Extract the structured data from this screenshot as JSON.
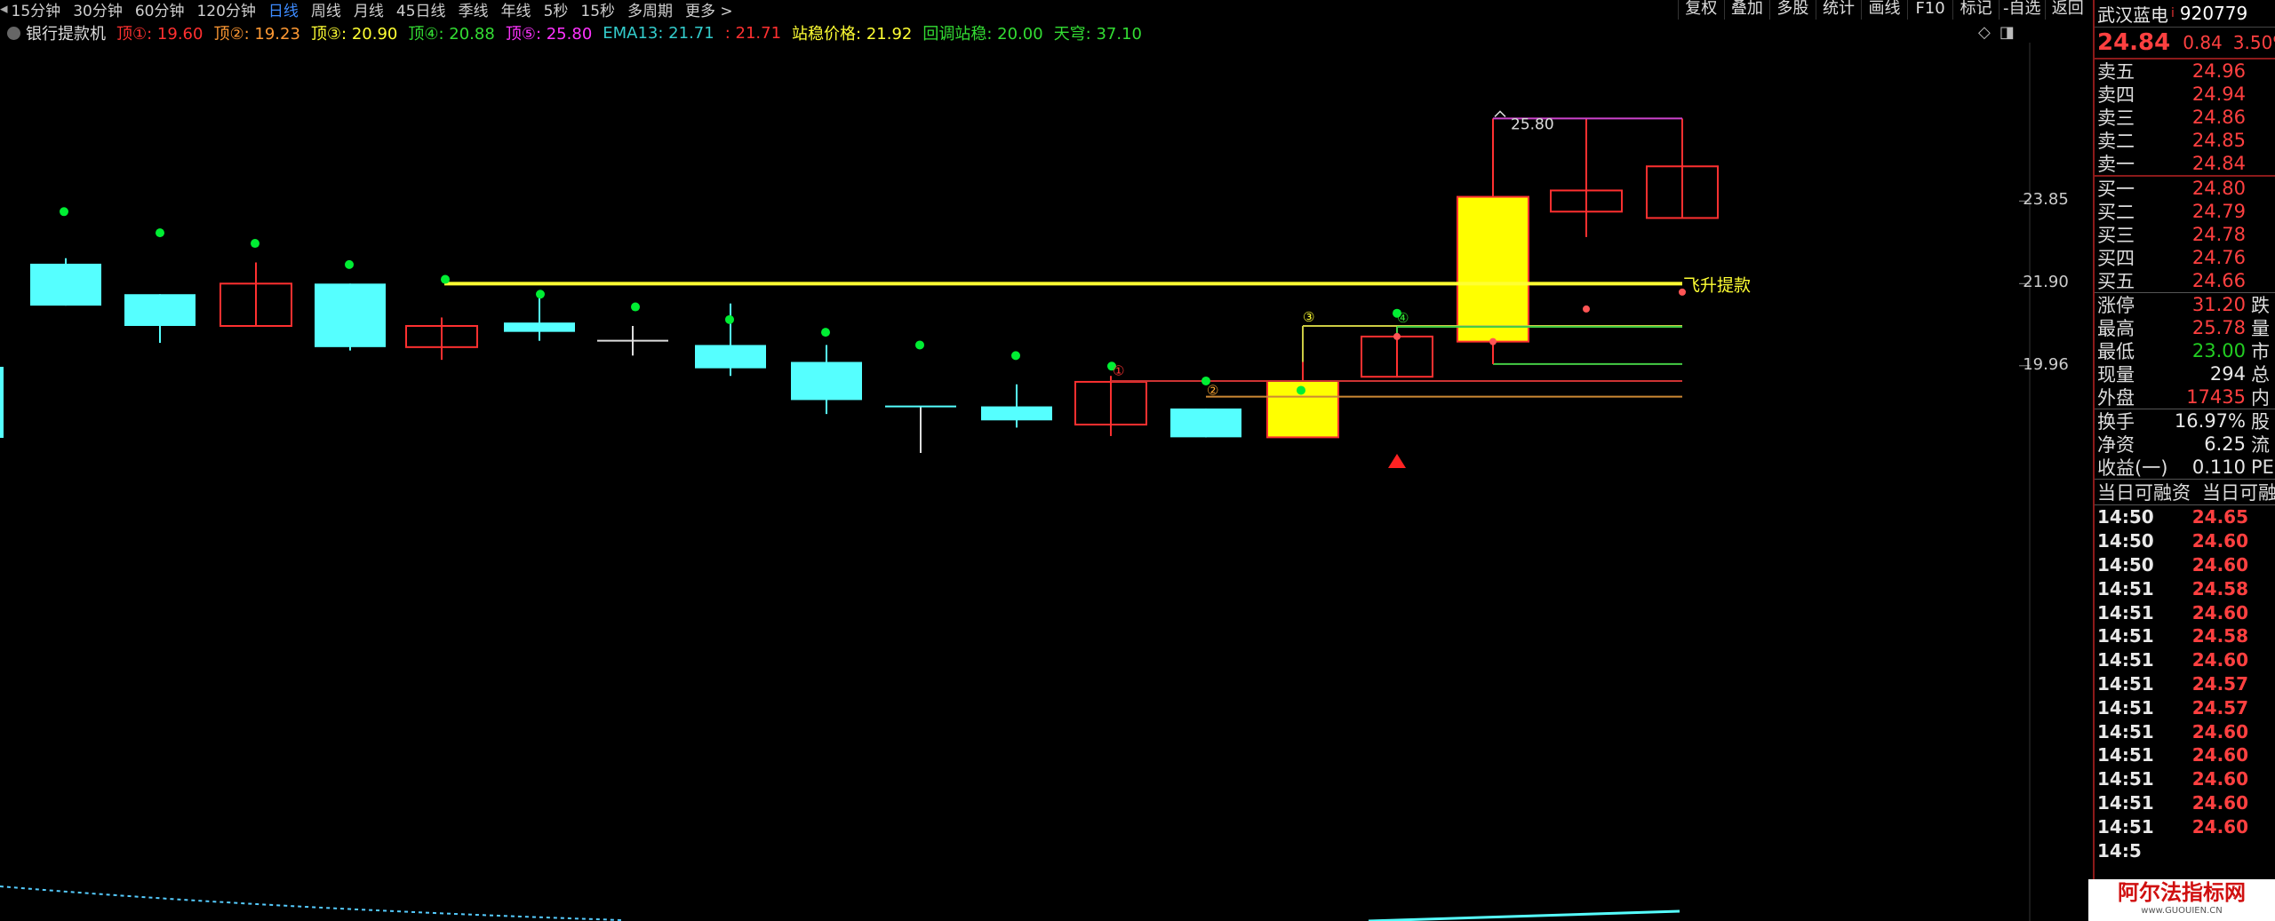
{
  "periods": {
    "items": [
      "15分钟",
      "30分钟",
      "60分钟",
      "120分钟",
      "日线",
      "周线",
      "月线",
      "45日线",
      "季线",
      "年线",
      "5秒",
      "15秒",
      "多周期",
      "更多 >"
    ],
    "active_index": 4
  },
  "toolbar": {
    "buttons": [
      "复权",
      "叠加",
      "多股",
      "统计",
      "画线",
      "F10",
      "标记",
      "-自选",
      "返回"
    ]
  },
  "indicator": {
    "name": "银行提款机",
    "items": [
      {
        "text": "顶①: 19.60",
        "color": "#ff3030"
      },
      {
        "text": "顶②: 19.23",
        "color": "#ff9933"
      },
      {
        "text": "顶③: 20.90",
        "color": "#ffff33"
      },
      {
        "text": "顶④: 20.88",
        "color": "#33dd33"
      },
      {
        "text": "顶⑤: 25.80",
        "color": "#ff33ff"
      },
      {
        "text": "EMA13: 21.71",
        "color": "#33cccc"
      },
      {
        "text": ": 21.71",
        "color": "#ff3030"
      },
      {
        "text": "站稳价格: 21.92",
        "color": "#ffff33"
      },
      {
        "text": "回调站稳: 20.00",
        "color": "#33dd33"
      },
      {
        "text": "天穹: 37.10",
        "color": "#33dd33"
      }
    ]
  },
  "window_icons": [
    "◇",
    "◨"
  ],
  "chart": {
    "y_labels": [
      {
        "text": "23.85",
        "value": 23.85
      },
      {
        "text": "21.90",
        "value": 21.9
      },
      {
        "text": "19.96",
        "value": 19.96
      }
    ],
    "high_label": "25.80",
    "line_label": "飞升提款",
    "markers": [
      "①",
      "②",
      "③",
      "④"
    ],
    "colors": {
      "up": "#ff3030",
      "down": "#55ffff",
      "signal": "#ffff00",
      "dot_green": "#00ee33",
      "dot_red": "#ff5555",
      "yellow_line": "#ffff33"
    }
  },
  "stock": {
    "name": "武汉蓝电",
    "code": "920779",
    "price": "24.84",
    "change": "0.84",
    "change_pct": "3.50%"
  },
  "asks": [
    {
      "label": "卖五",
      "price": "24.96"
    },
    {
      "label": "卖四",
      "price": "24.94"
    },
    {
      "label": "卖三",
      "price": "24.86"
    },
    {
      "label": "卖二",
      "price": "24.85"
    },
    {
      "label": "卖一",
      "price": "24.84"
    }
  ],
  "bids": [
    {
      "label": "买一",
      "price": "24.80"
    },
    {
      "label": "买二",
      "price": "24.79"
    },
    {
      "label": "买三",
      "price": "24.78"
    },
    {
      "label": "买四",
      "price": "24.76"
    },
    {
      "label": "买五",
      "price": "24.66"
    }
  ],
  "stats1": [
    {
      "label": "涨停",
      "value": "31.20",
      "color": "red",
      "extra": "跌"
    },
    {
      "label": "最高",
      "value": "25.78",
      "color": "red",
      "extra": "量"
    },
    {
      "label": "最低",
      "value": "23.00",
      "color": "green",
      "extra": "市"
    },
    {
      "label": "现量",
      "value": "294",
      "color": "white",
      "extra": "总"
    },
    {
      "label": "外盘",
      "value": "17435",
      "color": "red",
      "extra": "内"
    }
  ],
  "stats2": [
    {
      "label": "换手",
      "value": "16.97%",
      "color": "white",
      "extra": "股"
    },
    {
      "label": "净资",
      "value": "6.25",
      "color": "white",
      "extra": "流"
    },
    {
      "label": "收益(一)",
      "value": "0.110",
      "color": "white",
      "extra": "PE"
    }
  ],
  "ticks_head": [
    "当日可融资",
    "当日可融"
  ],
  "ticks": [
    {
      "time": "14:50",
      "price": "24.65"
    },
    {
      "time": "14:50",
      "price": "24.60"
    },
    {
      "time": "14:50",
      "price": "24.60"
    },
    {
      "time": "14:51",
      "price": "24.58"
    },
    {
      "time": "14:51",
      "price": "24.60"
    },
    {
      "time": "14:51",
      "price": "24.58"
    },
    {
      "time": "14:51",
      "price": "24.60"
    },
    {
      "time": "14:51",
      "price": "24.57"
    },
    {
      "time": "14:51",
      "price": "24.57"
    },
    {
      "time": "14:51",
      "price": "24.60"
    },
    {
      "time": "14:51",
      "price": "24.60"
    },
    {
      "time": "14:51",
      "price": "24.60"
    },
    {
      "time": "14:51",
      "price": "24.60"
    },
    {
      "time": "14:51",
      "price": "24.60"
    },
    {
      "time": "14:5",
      "price": ""
    }
  ],
  "watermark": {
    "line1": "阿尔法指标网",
    "line2": "www.GUOUIEN.CN"
  }
}
